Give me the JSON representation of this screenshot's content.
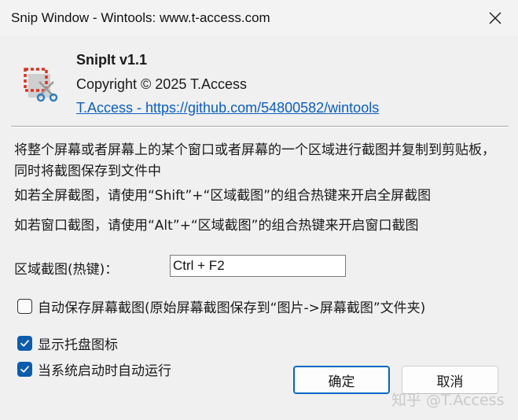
{
  "window": {
    "title": "Snip Window - Wintools: www.t-access.com"
  },
  "about": {
    "app_name": "SnipIt v1.1",
    "copyright": "Copyright © 2025 T.Access",
    "link_text": "T.Access - https://github.com/54800582/wintools"
  },
  "descriptions": [
    "将整个屏幕或者屏幕上的某个窗口或者屏幕的一个区域进行截图并复制到剪贴板，同时将截图保存到文件中",
    "如若全屏截图，请使用“Shift”+“区域截图”的组合热键来开启全屏截图",
    "如若窗口截图，请使用“Alt”+“区域截图”的组合热键来开启窗口截图"
  ],
  "hotkey": {
    "label": "区域截图(热键)：",
    "value": "Ctrl + F2"
  },
  "options": {
    "auto_save": {
      "label": "自动保存屏幕截图(原始屏幕截图保存到“图片->屏幕截图”文件夹)",
      "checked": false
    },
    "show_tray": {
      "label": "显示托盘图标",
      "checked": true
    },
    "autorun": {
      "label": "当系统启动时自动运行",
      "checked": true
    }
  },
  "buttons": {
    "ok": "确定",
    "cancel": "取消"
  },
  "watermark": "知乎 @T.Access",
  "colors": {
    "accent": "#0b5cad",
    "link": "#0a5ec2",
    "logo_red": "#e0301e",
    "logo_blue": "#2f7fc1"
  },
  "icons": {
    "close": "close-icon",
    "app_logo": "snip-logo-icon",
    "check": "check-icon"
  }
}
